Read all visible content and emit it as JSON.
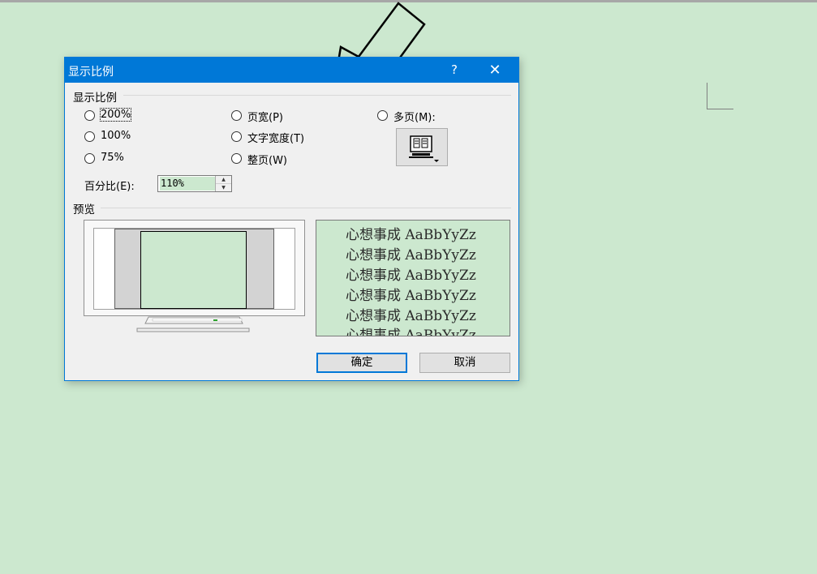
{
  "dialog": {
    "title": "显示比例",
    "help": "?",
    "close": "✕",
    "group_zoom": "显示比例",
    "radios": {
      "r200": "200%",
      "r100": "100%",
      "r75": "75%",
      "page_width": "页宽(P)",
      "text_width": "文字宽度(T)",
      "whole_page": "整页(W)",
      "many_pages": "多页(M):"
    },
    "percent_label": "百分比(E):",
    "percent_value": "110%",
    "group_preview": "预览",
    "sample_lines": [
      "心想事成 AaBbYyZz",
      "心想事成 AaBbYyZz",
      "心想事成 AaBbYyZz",
      "心想事成 AaBbYyZz",
      "心想事成 AaBbYyZz",
      "心想事成 AaBbYyZz"
    ],
    "ok": "确定",
    "cancel": "取消"
  }
}
